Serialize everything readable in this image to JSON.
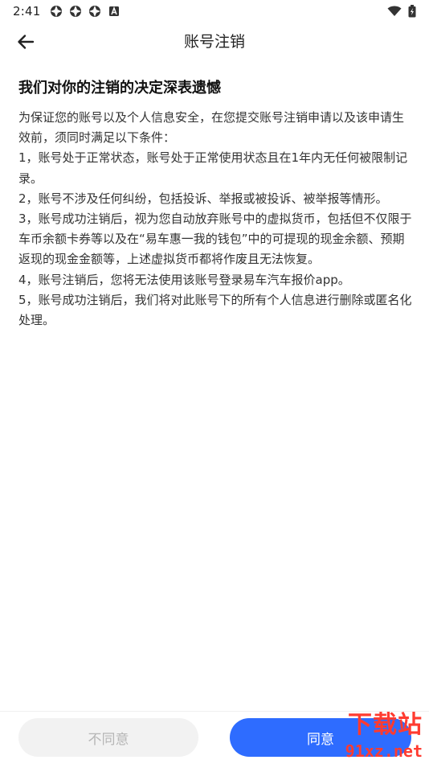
{
  "status_bar": {
    "time": "2:41",
    "left_icons": [
      "app-notify-icon",
      "app-notify-icon",
      "app-notify-icon",
      "a-box-icon"
    ],
    "right_icons": [
      "wifi-icon",
      "battery-icon"
    ]
  },
  "header": {
    "back_icon": "arrow-left-icon",
    "title": "账号注销"
  },
  "content": {
    "headline": "我们对你的注销的决定深表遗憾",
    "intro": "为保证您的账号以及个人信息安全，在您提交账号注销申请以及该申请生效前，须同时满足以下条件：",
    "conditions": [
      "1，账号处于正常状态，账号处于正常使用状态且在1年内无任何被限制记录。",
      "2，账号不涉及任何纠纷，包括投诉、举报或被投诉、被举报等情形。",
      "3，账号成功注销后，视为您自动放弃账号中的虚拟货币，包括但不仅限于车币余额卡券等以及在“易车惠一我的钱包”中的可提现的现金余额、预期返现的现金金额等，上述虚拟货币都将作废且无法恢复。",
      "4，账号注销后，您将无法使用该账号登录易车汽车报价app。",
      "5，账号成功注销后，我们将对此账号下的所有个人信息进行删除或匿名化处理。"
    ]
  },
  "bottom": {
    "disagree_label": "不同意",
    "agree_label": "同意"
  },
  "watermark": {
    "top": "下载站",
    "bottom": "91xz.net"
  },
  "colors": {
    "accent": "#2e6cff",
    "disabled_bg": "#f2f2f2",
    "disabled_text": "#b6b6b6",
    "watermark": "#ff3b30"
  }
}
